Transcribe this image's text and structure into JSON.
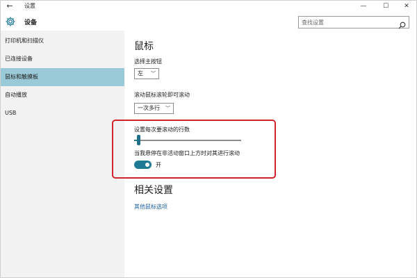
{
  "window": {
    "title": "设置",
    "back_glyph": "←",
    "min_glyph": "—",
    "max_glyph": "☐",
    "close_glyph": "✕"
  },
  "header": {
    "app_name": "设备",
    "search_placeholder": "查找设置"
  },
  "sidebar": {
    "items": [
      {
        "label": "打印机和扫描仪",
        "selected": false
      },
      {
        "label": "已连接设备",
        "selected": false
      },
      {
        "label": "鼠标和触摸板",
        "selected": true
      },
      {
        "label": "自动播放",
        "selected": false
      },
      {
        "label": "USB",
        "selected": false
      }
    ]
  },
  "main": {
    "title": "鼠标",
    "primary_button": {
      "label": "选择主按钮",
      "value": "左"
    },
    "scroll_mode": {
      "label": "滚动鼠标滚轮即可滚动",
      "value": "一次多行"
    },
    "scroll_lines": {
      "label": "设置每次要滚动的行数",
      "level_fraction": 0.03
    },
    "inactive_scroll": {
      "label": "当我悬停在非活动窗口上方时对其进行滚动",
      "state": "开",
      "on": true
    },
    "related": {
      "title": "相关设置",
      "link": "其他鼠标选项"
    }
  },
  "colors": {
    "accent": "#1f7a94",
    "selected_bg": "#9ac9d7",
    "highlight_border": "#d0222a",
    "link": "#1b5e9e",
    "sidebar_bg": "#f2f2f2"
  }
}
